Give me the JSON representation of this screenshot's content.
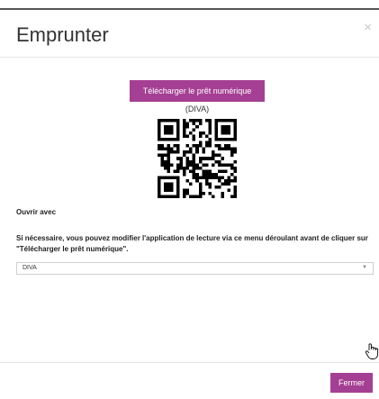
{
  "modal": {
    "title": "Emprunter",
    "close_glyph": "×"
  },
  "download": {
    "button_label": "Télécharger le prêt numérique",
    "app_note": "(DIVA)"
  },
  "qr": {
    "icon": "qr-code"
  },
  "open_with": {
    "label": "Ouvrir avec",
    "help_text": "Si nécessaire, vous pouvez modifier l'application de lecture via ce menu déroulant avant de cliquer sur \"Télécharger le prêt numérique\".",
    "selected": "DIVA",
    "chevron": "▼"
  },
  "footer": {
    "close_label": "Fermer"
  },
  "colors": {
    "accent": "#a53f93",
    "text": "#333333",
    "divider": "#e5e5e5"
  }
}
